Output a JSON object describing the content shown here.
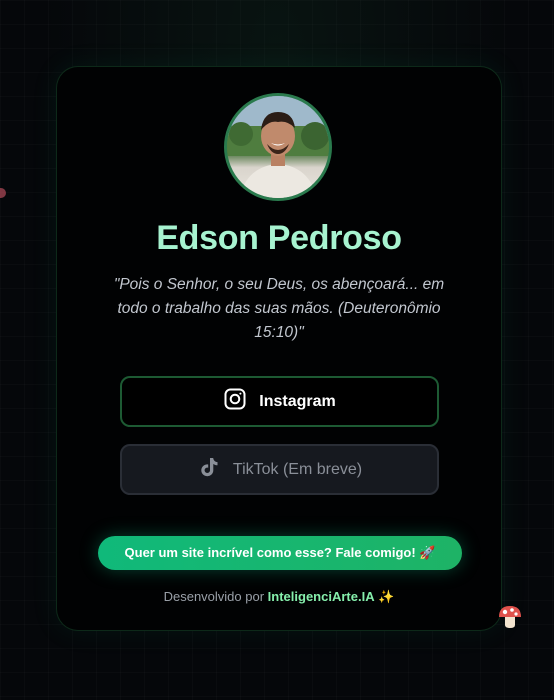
{
  "profile": {
    "name": "Edson Pedroso",
    "quote": "\"Pois o Senhor, o seu Deus, os abençoará... em todo o trabalho das suas mãos. (Deuteronômio 15:10)\""
  },
  "links": {
    "instagram_label": "Instagram",
    "tiktok_label": "TikTok (Em breve)"
  },
  "cta": {
    "label": "Quer um site incrível como esse? Fale comigo! 🚀"
  },
  "footer": {
    "prefix": "Desenvolvido por",
    "brand": "InteligenciArte.IA",
    "emoji": "✨"
  },
  "icons": [
    "instagram-icon",
    "tiktok-icon",
    "mushroom-icon"
  ],
  "colors": {
    "accent": "#a7f3d0",
    "cta": "#10b97a",
    "brand": "#86efac"
  }
}
